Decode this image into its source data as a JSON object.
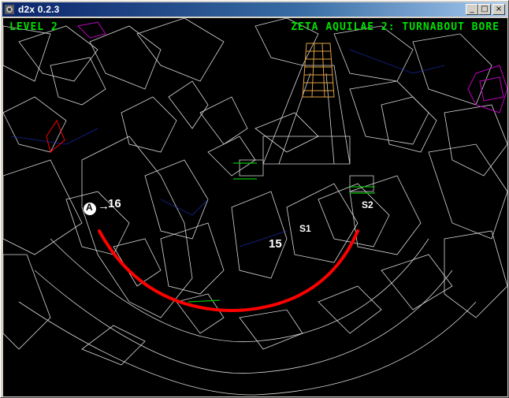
{
  "window": {
    "title": "d2x 0.2.3",
    "buttons": {
      "minimize": "_",
      "maximize": "□",
      "close": "×"
    }
  },
  "hud": {
    "level_label": "LEVEL 2",
    "mine_name": "ZETA AQUILAE 2: TURNABOUT BORE",
    "text_color": "#00e000"
  },
  "markers": {
    "player_badge": "A",
    "player_segment": "16",
    "arrow": "→",
    "segment_15": "15",
    "s1": "S1",
    "s2": "S2"
  },
  "colors": {
    "wireframe": "#ffffff",
    "path": "#ff0000",
    "door": "#00c000",
    "energy_center": "#e0a040",
    "reactor": "#c000c0",
    "hostage": "#ff0000",
    "background": "#000000"
  },
  "icons": {
    "app": "d2x-icon"
  }
}
